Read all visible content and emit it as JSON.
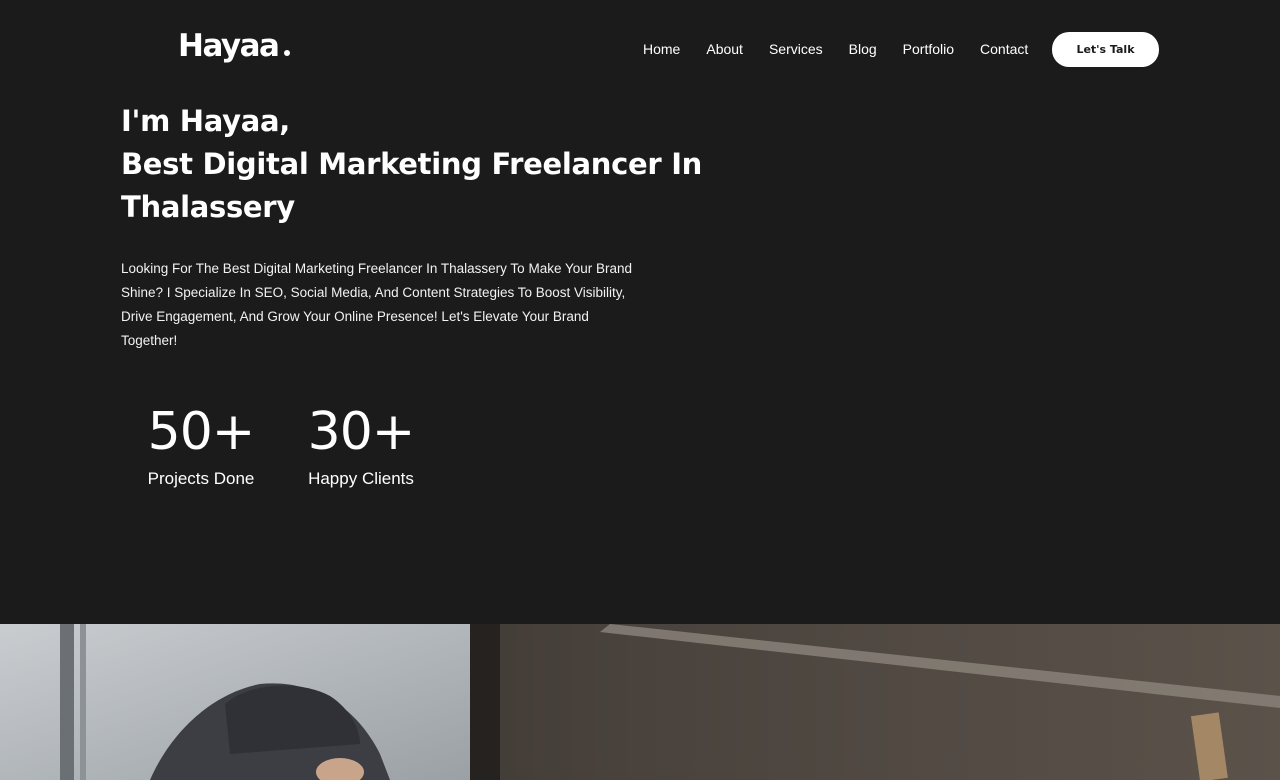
{
  "header": {
    "logo_text": "Hayaa",
    "nav": [
      "Home",
      "About",
      "Services",
      "Blog",
      "Portfolio",
      "Contact"
    ],
    "cta_label": "Let's Talk"
  },
  "hero": {
    "title_line1": "I'm Hayaa,",
    "title_line2": "Best Digital Marketing Freelancer In",
    "title_line3": "Thalassery",
    "description": "Looking For The Best Digital Marketing Freelancer In Thalassery To Make Your Brand Shine?  I Specialize In SEO, Social Media, And Content Strategies To Boost Visibility, Drive Engagement, And Grow Your Online Presence! Let's Elevate Your Brand Together!"
  },
  "stats": [
    {
      "number": "50+",
      "label": "Projects Done"
    },
    {
      "number": "30+",
      "label": "Happy Clients"
    }
  ],
  "colors": {
    "background": "#1b1b1b",
    "text": "#ffffff",
    "button_bg": "#ffffff",
    "button_text": "#1b1b1b"
  }
}
